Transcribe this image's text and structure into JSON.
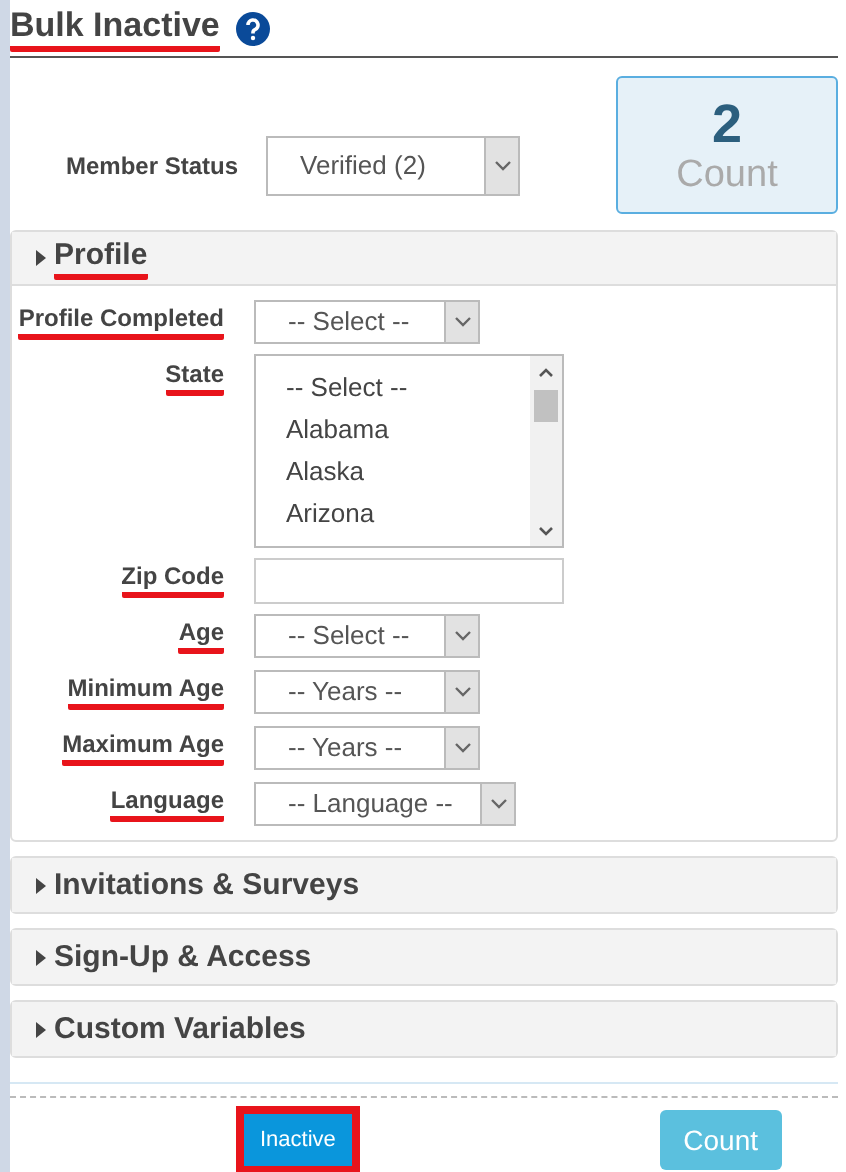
{
  "page": {
    "title": "Bulk Inactive",
    "annotated": true
  },
  "member_status": {
    "label": "Member Status",
    "value": "Verified (2)"
  },
  "count_box": {
    "number": "2",
    "label": "Count"
  },
  "sections": [
    {
      "title": "Profile",
      "expanded": true,
      "annotated": true,
      "fields": [
        {
          "kind": "select",
          "label": "Profile Completed",
          "value": "-- Select --",
          "annotated": true
        },
        {
          "kind": "listbox",
          "label": "State",
          "annotated": true,
          "options": [
            "-- Select --",
            "Alabama",
            "Alaska",
            "Arizona"
          ]
        },
        {
          "kind": "text",
          "label": "Zip Code",
          "annotated": true
        },
        {
          "kind": "select",
          "label": "Age",
          "value": "-- Select --",
          "annotated": true
        },
        {
          "kind": "select",
          "label": "Minimum Age",
          "value": "-- Years --",
          "annotated": true
        },
        {
          "kind": "select",
          "label": "Maximum Age",
          "value": "-- Years --",
          "annotated": true
        },
        {
          "kind": "select",
          "label": "Language",
          "value": "-- Language --",
          "annotated": true
        }
      ]
    },
    {
      "title": "Invitations & Surveys",
      "expanded": false,
      "annotated": false
    },
    {
      "title": "Sign-Up & Access",
      "expanded": false,
      "annotated": false
    },
    {
      "title": "Custom Variables",
      "expanded": false,
      "annotated": false
    }
  ],
  "buttons": [
    {
      "label": "Inactive",
      "kind": "primary",
      "annotated": true
    },
    {
      "label": "Count",
      "kind": "secondary",
      "annotated": false
    }
  ]
}
